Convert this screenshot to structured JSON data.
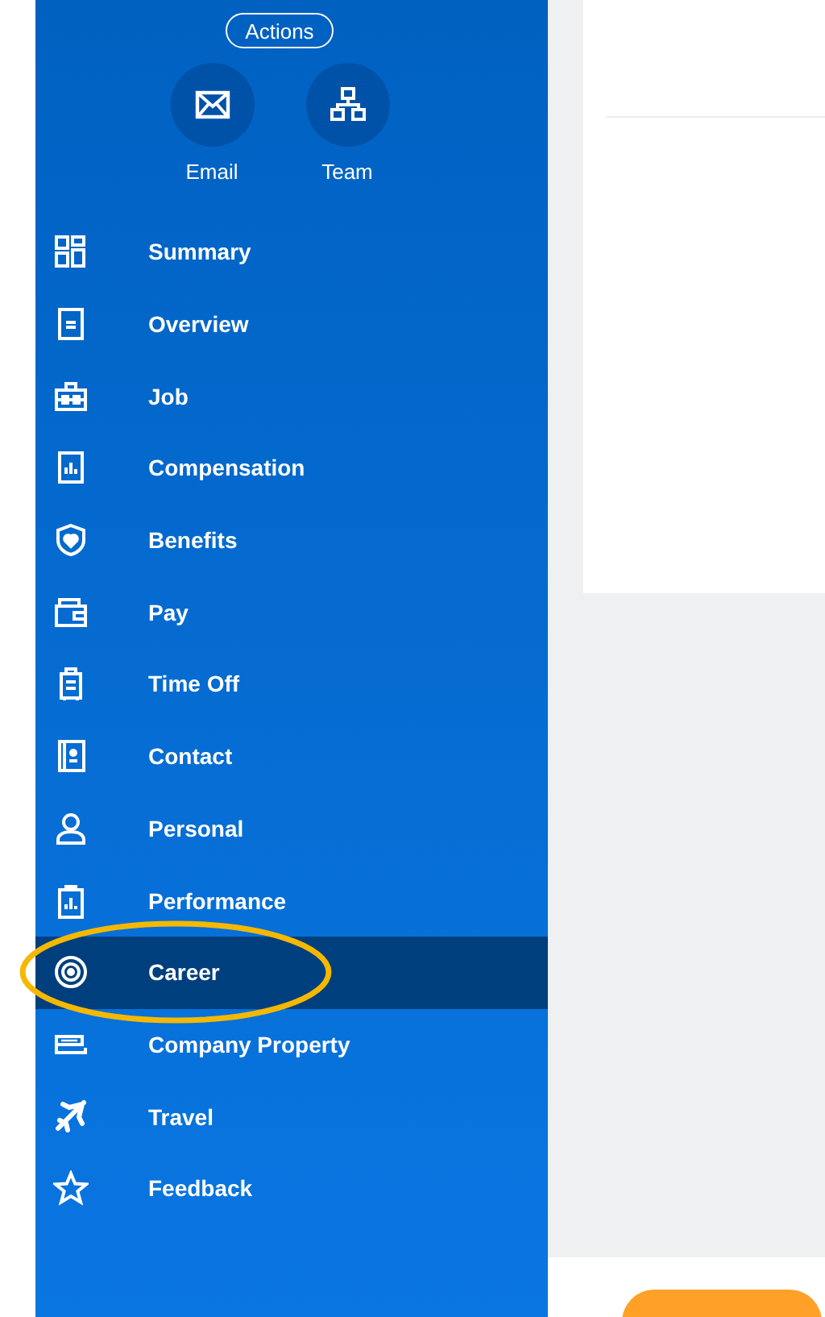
{
  "actions_button": "Actions",
  "quick_actions": [
    {
      "kind": "mail",
      "label": "Email"
    },
    {
      "kind": "team",
      "label": "Team"
    }
  ],
  "nav": [
    {
      "kind": "grid",
      "label": "Summary",
      "selected": false,
      "circled": false
    },
    {
      "kind": "document",
      "label": "Overview",
      "selected": false,
      "circled": false
    },
    {
      "kind": "toolbox",
      "label": "Job",
      "selected": false,
      "circled": false
    },
    {
      "kind": "chart",
      "label": "Compensation",
      "selected": false,
      "circled": false
    },
    {
      "kind": "shield",
      "label": "Benefits",
      "selected": false,
      "circled": false
    },
    {
      "kind": "wallet",
      "label": "Pay",
      "selected": false,
      "circled": false
    },
    {
      "kind": "luggage",
      "label": "Time Off",
      "selected": false,
      "circled": false
    },
    {
      "kind": "contact",
      "label": "Contact",
      "selected": false,
      "circled": false
    },
    {
      "kind": "person",
      "label": "Personal",
      "selected": false,
      "circled": false
    },
    {
      "kind": "clipboard",
      "label": "Performance",
      "selected": false,
      "circled": false
    },
    {
      "kind": "target",
      "label": "Career",
      "selected": true,
      "circled": true
    },
    {
      "kind": "stapler",
      "label": "Company Property",
      "selected": false,
      "circled": false
    },
    {
      "kind": "plane",
      "label": "Travel",
      "selected": false,
      "circled": false
    },
    {
      "kind": "star",
      "label": "Feedback",
      "selected": false,
      "circled": false
    }
  ]
}
